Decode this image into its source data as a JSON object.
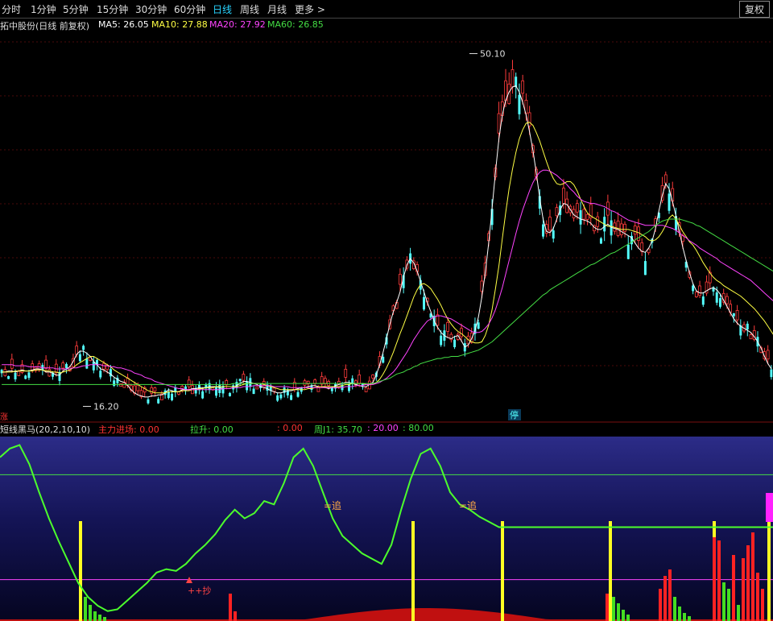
{
  "toolbar": {
    "items": [
      "分时",
      "1分钟",
      "5分钟",
      "15分钟",
      "30分钟",
      "60分钟",
      "日线",
      "周线",
      "月线",
      "更多 >"
    ],
    "active_index": 6,
    "fq_label": "复权"
  },
  "main_chart": {
    "title": "拓中股份(日线 前复权)",
    "ma5": "MA5: 26.05",
    "ma10": "MA10: 27.88",
    "ma20": "MA20: 27.92",
    "ma60": "MA60: 26.85",
    "high_label": "50.10",
    "low_label": "16.20",
    "stop_badge": "停",
    "corner_tag": "涨"
  },
  "sub_chart": {
    "title": "短线黑马(20,2,10,10)",
    "zhuli": "主力进场: 0.00",
    "lasheng": "拉升: 0.00",
    "colon_val": ": 0.00",
    "zhouj1": "周J1: 35.70",
    "v20": ": 20.00",
    "v80": ": 80.00",
    "zhui_label": "=追",
    "chao_label": "++抄"
  },
  "colors": {
    "up": "#ff3c3c",
    "down": "#54ffff",
    "ma5": "#ffffff",
    "ma10": "#ffff44",
    "ma20": "#ff44ff",
    "ma60": "#44dd44",
    "j_line": "#4cff2c",
    "yellow_bar": "#ffff22",
    "green_bar": "#44dd22",
    "red_bar": "#ff2222"
  },
  "chart_data": [
    {
      "type": "candlestick",
      "series": [
        {
          "name": "MA5",
          "values": [
            19.5,
            19.5,
            19.6,
            19.6,
            19.5,
            19.6,
            19.7,
            19.6,
            19.6,
            19.7,
            19.8,
            19.8,
            19.7,
            19.5,
            19.5,
            19.4,
            19.2,
            19.2,
            19.6,
            19.8,
            20.0,
            20.5,
            21.2,
            21.5,
            21.5,
            21.3,
            21.0,
            20.5,
            20.2,
            19.8,
            19.7,
            19.5,
            19.3,
            19.0,
            18.8,
            18.6,
            18.5,
            18.2,
            17.8,
            17.5,
            17.3,
            17.2,
            17.1,
            17.1,
            17.2,
            17.2,
            17.3,
            17.3,
            17.5,
            17.8,
            17.7,
            17.6,
            17.6,
            17.8,
            17.8,
            17.8,
            17.9,
            17.9,
            18.0,
            18.0,
            18.0,
            18.1,
            18.1,
            18.1,
            18.0,
            17.9,
            17.9,
            17.9,
            18.0,
            18.2,
            18.4,
            18.6,
            18.6,
            18.5,
            18.4,
            18.3,
            18.1,
            18.0,
            17.9,
            17.7,
            17.6,
            17.5,
            17.5,
            17.6,
            17.7,
            17.7,
            17.8,
            17.9,
            18.0,
            18.0,
            18.1,
            18.2,
            18.2,
            18.1,
            18.1,
            18.0,
            17.9,
            18.0,
            18.2,
            18.3,
            18.4,
            18.5,
            18.5,
            18.4,
            18.3,
            18.2,
            18.1,
            18.1,
            18.3,
            18.5,
            19.2,
            20.2,
            21.4,
            22.7,
            24.1,
            25.3,
            26.2,
            27.2,
            28.6,
            29.8,
            30.4,
            30.0,
            29.2,
            28.2,
            27.2,
            26.2,
            25.3,
            24.4,
            23.8,
            23.3,
            23.0,
            22.8,
            22.7,
            22.9,
            23.0,
            22.5,
            21.9,
            22.1,
            22.7,
            23.5,
            24.8,
            26.7,
            29.0,
            31.9,
            35.2,
            38.7,
            41.9,
            44.2,
            45.6,
            46.4,
            46.9,
            47.0,
            46.4,
            45.4,
            44.2,
            42.6,
            40.8,
            38.6,
            36.2,
            34.2,
            33.0,
            32.9,
            33.3,
            34.2,
            35.1,
            35.7,
            35.6,
            35.1,
            34.6,
            34.4,
            34.2,
            34.1,
            34.0,
            33.8,
            33.4,
            33.2,
            33.2,
            33.5,
            33.7,
            33.4,
            33.3,
            33.2,
            33.0,
            32.8,
            32.6,
            32.4,
            31.9,
            31.4,
            31.1,
            31.0,
            31.4,
            32.1,
            33.3,
            35.0,
            36.5,
            37.6,
            37.1,
            35.9,
            34.5,
            33.0,
            31.5,
            30.2,
            29.0,
            28.0,
            27.3,
            27.1,
            27.1,
            27.3,
            27.5,
            27.6,
            27.4,
            27.0,
            26.4,
            25.8,
            25.2,
            24.6,
            24.2,
            23.9,
            23.7,
            23.5,
            23.3,
            22.9,
            22.4,
            21.8,
            21.0,
            20.3,
            19.8
          ]
        },
        {
          "name": "MA10",
          "values": [
            19.5,
            19.5,
            19.5,
            19.5,
            19.6,
            19.6,
            19.6,
            19.6,
            19.6,
            19.6,
            19.7,
            19.7,
            19.7,
            19.6,
            19.6,
            19.5,
            19.5,
            19.4,
            19.5,
            19.6,
            19.7,
            19.9,
            20.2,
            20.4,
            20.6,
            20.8,
            21.0,
            21.0,
            20.8,
            20.6,
            20.4,
            20.2,
            20.0,
            19.7,
            19.5,
            19.3,
            19.1,
            18.9,
            18.7,
            18.5,
            18.3,
            18.1,
            17.9,
            17.7,
            17.6,
            17.5,
            17.5,
            17.5,
            17.5,
            17.6,
            17.6,
            17.6,
            17.6,
            17.7,
            17.7,
            17.7,
            17.8,
            17.8,
            17.9,
            17.9,
            18.0,
            18.0,
            18.0,
            18.1,
            18.1,
            18.1,
            18.1,
            18.1,
            18.1,
            18.1,
            18.2,
            18.3,
            18.4,
            18.4,
            18.4,
            18.4,
            18.4,
            18.3,
            18.2,
            18.1,
            18.0,
            17.9,
            17.8,
            17.8,
            17.8,
            17.8,
            17.8,
            17.8,
            17.8,
            17.8,
            17.9,
            17.9,
            18.0,
            18.1,
            18.1,
            18.1,
            18.1,
            18.1,
            18.1,
            18.1,
            18.2,
            18.3,
            18.3,
            18.4,
            18.4,
            18.4,
            18.4,
            18.3,
            18.3,
            18.3,
            18.5,
            18.8,
            19.3,
            19.9,
            20.6,
            21.4,
            22.3,
            23.2,
            24.0,
            24.9,
            25.8,
            26.7,
            27.4,
            27.9,
            28.0,
            27.8,
            27.5,
            27.0,
            26.5,
            25.9,
            25.2,
            24.6,
            24.1,
            23.7,
            23.4,
            23.2,
            22.9,
            22.6,
            22.4,
            22.3,
            22.3,
            22.4,
            23.0,
            24.0,
            25.5,
            27.5,
            29.7,
            32.3,
            34.8,
            37.1,
            39.0,
            40.6,
            41.9,
            42.8,
            43.4,
            43.5,
            43.2,
            42.5,
            41.7,
            40.7,
            39.7,
            38.8,
            38.1,
            37.6,
            37.5,
            37.6,
            37.8,
            37.8,
            37.5,
            36.9,
            36.1,
            35.4,
            34.8,
            34.5,
            34.3,
            34.1,
            33.9,
            33.7,
            33.5,
            33.5,
            33.4,
            33.3,
            33.2,
            33.2,
            33.2,
            33.1,
            33.0,
            32.9,
            32.7,
            32.5,
            32.2,
            32.1,
            32.2,
            32.5,
            33.0,
            33.6,
            34.3,
            34.6,
            34.2,
            33.6,
            33.0,
            32.5,
            32.0,
            31.7,
            31.2,
            30.6,
            30.0,
            29.5,
            29.0,
            28.6,
            28.3,
            28.1,
            27.8,
            27.6,
            27.4,
            27.2,
            27.0,
            26.8,
            26.5,
            26.2,
            25.9,
            25.6,
            25.2,
            24.8,
            24.4,
            23.9,
            23.4,
            22.9,
            22.4
          ]
        },
        {
          "name": "MA20",
          "values": [
            20.2,
            20.2,
            20.2,
            20.2,
            20.1,
            20.1,
            20.1,
            20.1,
            20.0,
            20.0,
            20.0,
            20.0,
            19.9,
            19.9,
            19.9,
            19.9,
            19.8,
            19.8,
            19.8,
            19.8,
            19.8,
            19.9,
            19.9,
            20.0,
            20.1,
            20.1,
            20.2,
            20.2,
            20.2,
            20.2,
            20.1,
            20.1,
            20.0,
            20.0,
            19.9,
            19.9,
            19.8,
            19.7,
            19.6,
            19.4,
            19.3,
            19.2,
            19.0,
            18.9,
            18.8,
            18.6,
            18.5,
            18.4,
            18.3,
            18.2,
            18.1,
            18.0,
            17.9,
            17.9,
            17.8,
            17.8,
            17.8,
            17.8,
            17.8,
            17.8,
            17.8,
            17.8,
            17.8,
            17.8,
            17.8,
            17.9,
            17.9,
            17.9,
            18.0,
            18.0,
            18.0,
            18.1,
            18.1,
            18.1,
            18.2,
            18.2,
            18.2,
            18.2,
            18.2,
            18.2,
            18.1,
            18.1,
            18.1,
            18.1,
            18.1,
            18.0,
            18.0,
            18.0,
            18.0,
            18.0,
            18.0,
            18.0,
            18.0,
            18.0,
            18.0,
            18.0,
            18.0,
            18.0,
            18.0,
            18.0,
            18.0,
            18.1,
            18.1,
            18.1,
            18.2,
            18.2,
            18.2,
            18.3,
            18.3,
            18.3,
            18.4,
            18.5,
            18.7,
            18.9,
            19.2,
            19.5,
            19.9,
            20.4,
            20.9,
            21.4,
            22.0,
            22.6,
            23.1,
            23.6,
            24.0,
            24.4,
            24.6,
            24.8,
            24.9,
            24.9,
            24.8,
            24.7,
            24.6,
            24.4,
            24.2,
            24.0,
            23.8,
            23.6,
            23.4,
            23.3,
            23.3,
            23.4,
            23.7,
            24.1,
            24.7,
            25.5,
            26.5,
            27.6,
            28.9,
            30.2,
            31.5,
            32.8,
            34.0,
            35.1,
            36.0,
            36.9,
            37.7,
            38.3,
            38.7,
            38.9,
            38.9,
            38.8,
            38.6,
            38.4,
            38.1,
            37.8,
            37.5,
            37.1,
            36.8,
            36.4,
            36.1,
            35.9,
            35.8,
            35.7,
            35.7,
            35.6,
            35.5,
            35.4,
            35.2,
            35.0,
            34.9,
            34.7,
            34.5,
            34.3,
            34.1,
            34.0,
            33.9,
            33.8,
            33.7,
            33.6,
            33.6,
            33.6,
            33.6,
            33.6,
            33.6,
            33.5,
            33.4,
            33.3,
            33.1,
            32.9,
            32.6,
            32.4,
            32.1,
            31.9,
            31.7,
            31.4,
            31.2,
            31.0,
            30.8,
            30.6,
            30.4,
            30.1,
            29.9,
            29.7,
            29.5,
            29.3,
            29.1,
            28.9,
            28.7,
            28.5,
            28.3,
            28.0,
            27.7,
            27.4,
            27.1,
            26.8,
            26.5,
            26.2,
            25.9,
            25.5
          ]
        },
        {
          "name": "MA60",
          "values": [
            18.3,
            18.3,
            18.3,
            18.3,
            18.3,
            18.3,
            18.3,
            18.3,
            18.3,
            18.3,
            18.3,
            18.3,
            18.3,
            18.3,
            18.3,
            18.3,
            18.3,
            18.3,
            18.3,
            18.3,
            18.3,
            18.3,
            18.3,
            18.3,
            18.3,
            18.3,
            18.3,
            18.3,
            18.3,
            18.3,
            18.3,
            18.3,
            18.3,
            18.3,
            18.3,
            18.3,
            18.3,
            18.3,
            18.3,
            18.3,
            18.3,
            18.3,
            18.3,
            18.3,
            18.3,
            18.3,
            18.3,
            18.3,
            18.3,
            18.3,
            18.3,
            18.3,
            18.3,
            18.3,
            18.3,
            18.3,
            18.3,
            18.3,
            18.3,
            18.3,
            18.3,
            18.3,
            18.3,
            18.3,
            18.3,
            18.3,
            18.3,
            18.3,
            18.4,
            18.4,
            18.4,
            18.4,
            18.4,
            18.4,
            18.4,
            18.4,
            18.4,
            18.4,
            18.4,
            18.4,
            18.4,
            18.4,
            18.4,
            18.4,
            18.4,
            18.4,
            18.4,
            18.4,
            18.4,
            18.4,
            18.4,
            18.4,
            18.4,
            18.4,
            18.4,
            18.4,
            18.4,
            18.4,
            18.4,
            18.4,
            18.4,
            18.4,
            18.4,
            18.4,
            18.4,
            18.4,
            18.4,
            18.4,
            18.4,
            18.4,
            18.5,
            18.6,
            18.7,
            18.8,
            18.9,
            19.1,
            19.3,
            19.4,
            19.5,
            19.7,
            19.8,
            20.0,
            20.1,
            20.3,
            20.4,
            20.5,
            20.6,
            20.7,
            20.8,
            20.8,
            20.9,
            20.9,
            21.0,
            21.0,
            21.0,
            21.1,
            21.2,
            21.3,
            21.4,
            21.5,
            21.6,
            21.8,
            22.0,
            22.2,
            22.4,
            22.7,
            23.0,
            23.3,
            23.6,
            23.9,
            24.2,
            24.5,
            24.8,
            25.1,
            25.4,
            25.7,
            26.0,
            26.3,
            26.6,
            26.9,
            27.1,
            27.4,
            27.6,
            27.8,
            28.0,
            28.2,
            28.4,
            28.6,
            28.8,
            29.0,
            29.2,
            29.4,
            29.6,
            29.8,
            29.9,
            30.1,
            30.3,
            30.5,
            30.7,
            30.9,
            31.0,
            31.2,
            31.4,
            31.6,
            31.8,
            32.0,
            32.2,
            32.4,
            32.6,
            32.8,
            33.0,
            33.3,
            33.6,
            33.8,
            34.0,
            34.1,
            34.2,
            34.2,
            34.2,
            34.2,
            34.1,
            34.0,
            33.9,
            33.8,
            33.6,
            33.5,
            33.3,
            33.1,
            32.9,
            32.7,
            32.5,
            32.3,
            32.1,
            31.9,
            31.7,
            31.5,
            31.3,
            31.1,
            30.9,
            30.7,
            30.5,
            30.3,
            30.1,
            29.9,
            29.7,
            29.5,
            29.3,
            29.1,
            28.9,
            28.7
          ]
        }
      ],
      "ylim": [
        15,
        52
      ],
      "annotations": [
        "50.10",
        "16.20"
      ]
    },
    {
      "type": "line",
      "series": [
        {
          "name": "周J1",
          "values": [
            90,
            95,
            97,
            86,
            70,
            55,
            42,
            30,
            18,
            10,
            5,
            2,
            3,
            8,
            13,
            18,
            24,
            26,
            25,
            29,
            35,
            40,
            46,
            54,
            60,
            55,
            58,
            65,
            63,
            75,
            90,
            95,
            85,
            70,
            55,
            45,
            40,
            35,
            32,
            29,
            40,
            60,
            78,
            92,
            95,
            85,
            70,
            63,
            60,
            56,
            53,
            50,
            50,
            50,
            50,
            50,
            50,
            50,
            50,
            50,
            50,
            50,
            50,
            50,
            50,
            50,
            50,
            50,
            50,
            50,
            50,
            50,
            50,
            50,
            50,
            50,
            50,
            50,
            50,
            50
          ]
        },
        {
          "name": "20",
          "values": [
            20,
            20
          ]
        },
        {
          "name": "80",
          "values": [
            80,
            80
          ]
        }
      ],
      "ylim": [
        0,
        100
      ]
    }
  ]
}
